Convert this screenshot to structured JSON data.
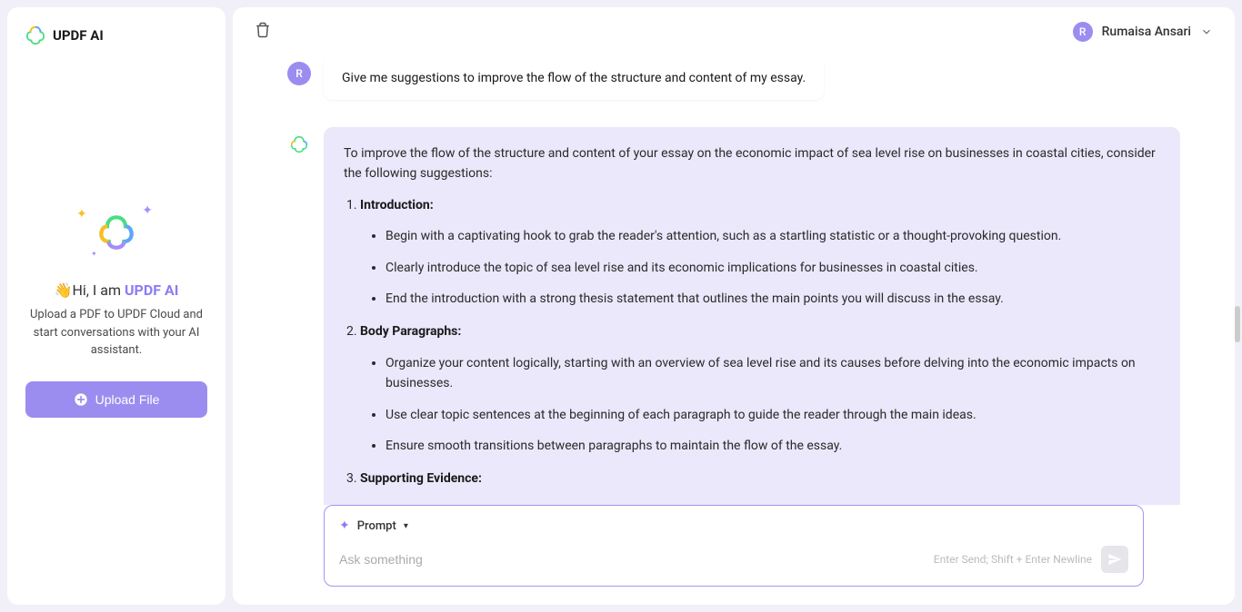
{
  "sidebar": {
    "title": "UPDF AI",
    "greeting_prefix": "👋Hi, I am ",
    "greeting_brand": "UPDF AI",
    "description": "Upload a PDF to UPDF Cloud and start conversations with your AI assistant.",
    "upload_label": "Upload File"
  },
  "header": {
    "user_initial": "R",
    "user_name": "Rumaisa Ansari"
  },
  "chat": {
    "user_initial": "R",
    "user_message": "Give me suggestions to improve the flow of the structure and content of my essay.",
    "ai_intro": "To improve the flow of the structure and content of your essay on the economic impact of sea level rise on businesses in coastal cities, consider the following suggestions:",
    "sections": [
      {
        "title": "Introduction:",
        "bullets": [
          "Begin with a captivating hook to grab the reader's attention, such as a startling statistic or a thought-provoking question.",
          "Clearly introduce the topic of sea level rise and its economic implications for businesses in coastal cities.",
          "End the introduction with a strong thesis statement that outlines the main points you will discuss in the essay."
        ]
      },
      {
        "title": "Body Paragraphs:",
        "bullets": [
          "Organize your content logically, starting with an overview of sea level rise and its causes before delving into the economic impacts on businesses.",
          "Use clear topic sentences at the beginning of each paragraph to guide the reader through the main ideas.",
          "Ensure smooth transitions between paragraphs to maintain the flow of the essay."
        ]
      },
      {
        "title": "Supporting Evidence:",
        "bullets": []
      }
    ]
  },
  "input": {
    "prompt_label": "Prompt",
    "placeholder": "Ask something",
    "hint": "Enter Send; Shift + Enter Newline"
  }
}
